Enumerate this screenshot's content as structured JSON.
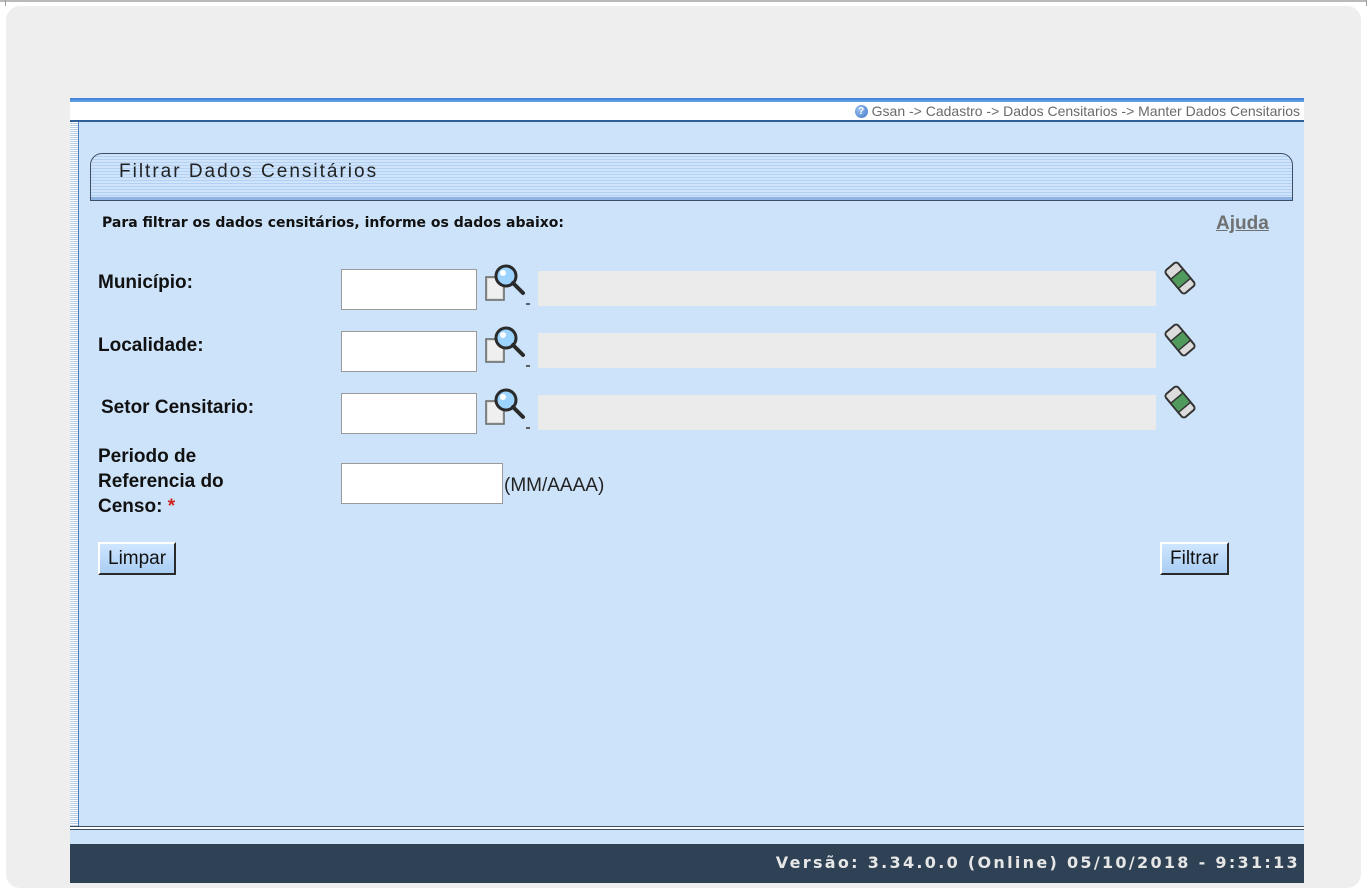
{
  "breadcrumb": {
    "help_icon": "help-circle-icon",
    "text": "Gsan -> Cadastro -> Dados Censitarios -> Manter Dados Censitarios"
  },
  "panel": {
    "title": "Filtrar Dados Censitários",
    "instructions": "Para filtrar os dados censitários, informe os dados abaixo:",
    "help_link": "Ajuda"
  },
  "form": {
    "municipio": {
      "label": "Município:",
      "code_value": "",
      "description_value": ""
    },
    "localidade": {
      "label": "Localidade:",
      "code_value": "",
      "description_value": ""
    },
    "setor": {
      "label": "Setor Censitario:",
      "code_value": "",
      "description_value": ""
    },
    "periodo": {
      "label_line1": "Periodo de",
      "label_line2": "Referencia do",
      "label_line3": "Censo:",
      "required_mark": "*",
      "value": "",
      "format_hint": "(MM/AAAA)"
    },
    "icons": {
      "lookup": "magnifier-search-icon",
      "clear": "eraser-icon"
    }
  },
  "buttons": {
    "clear_label": "Limpar",
    "filter_label": "Filtrar"
  },
  "footer": {
    "version": "Versão: 3.34.0.0 (Online) 05/10/2018 - 9:31:13"
  },
  "colors": {
    "background": "#cde3f9",
    "footer": "#2f4154",
    "required": "#d0251c"
  }
}
